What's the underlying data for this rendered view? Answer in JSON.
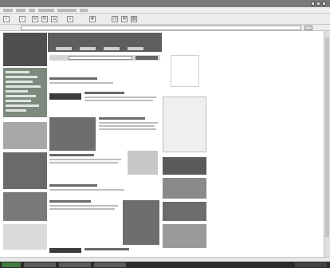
{
  "browser": {
    "window_controls": [
      {
        "icon": "minimize-icon"
      },
      {
        "icon": "maximize-icon"
      },
      {
        "icon": "close-icon"
      }
    ],
    "toolbar_icons": [
      "back-arrow-icon",
      "forward-arrow-icon",
      "stop-icon",
      "refresh-icon",
      "home-icon",
      "search-icon",
      "favorites-icon",
      "history-icon",
      "mail-icon",
      "print-icon"
    ],
    "address": {
      "value": ""
    },
    "status_text": ""
  },
  "page": {
    "logo_text": "",
    "search_placeholder": "",
    "search_button_label": ""
  },
  "colors": {
    "page_background": "#ffffff",
    "chrome_background": "#ececec",
    "taskbar": "#2b2b2b",
    "left_nav_panel": "#7d8a7d"
  }
}
